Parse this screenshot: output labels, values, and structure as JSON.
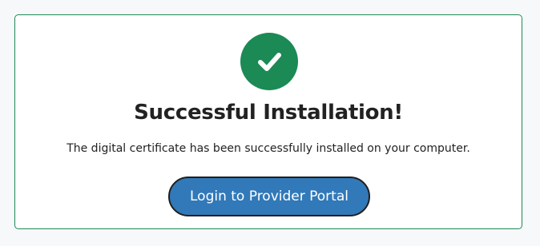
{
  "dialog": {
    "icon": "check-circle-icon",
    "title": "Successful Installation!",
    "message": "The digital certificate has been successfully installed on your computer.",
    "primary_button_label": "Login to Provider Portal"
  },
  "colors": {
    "success": "#1b8a55",
    "button": "#3179b9",
    "text": "#222222",
    "background": "#f7f8f9"
  }
}
